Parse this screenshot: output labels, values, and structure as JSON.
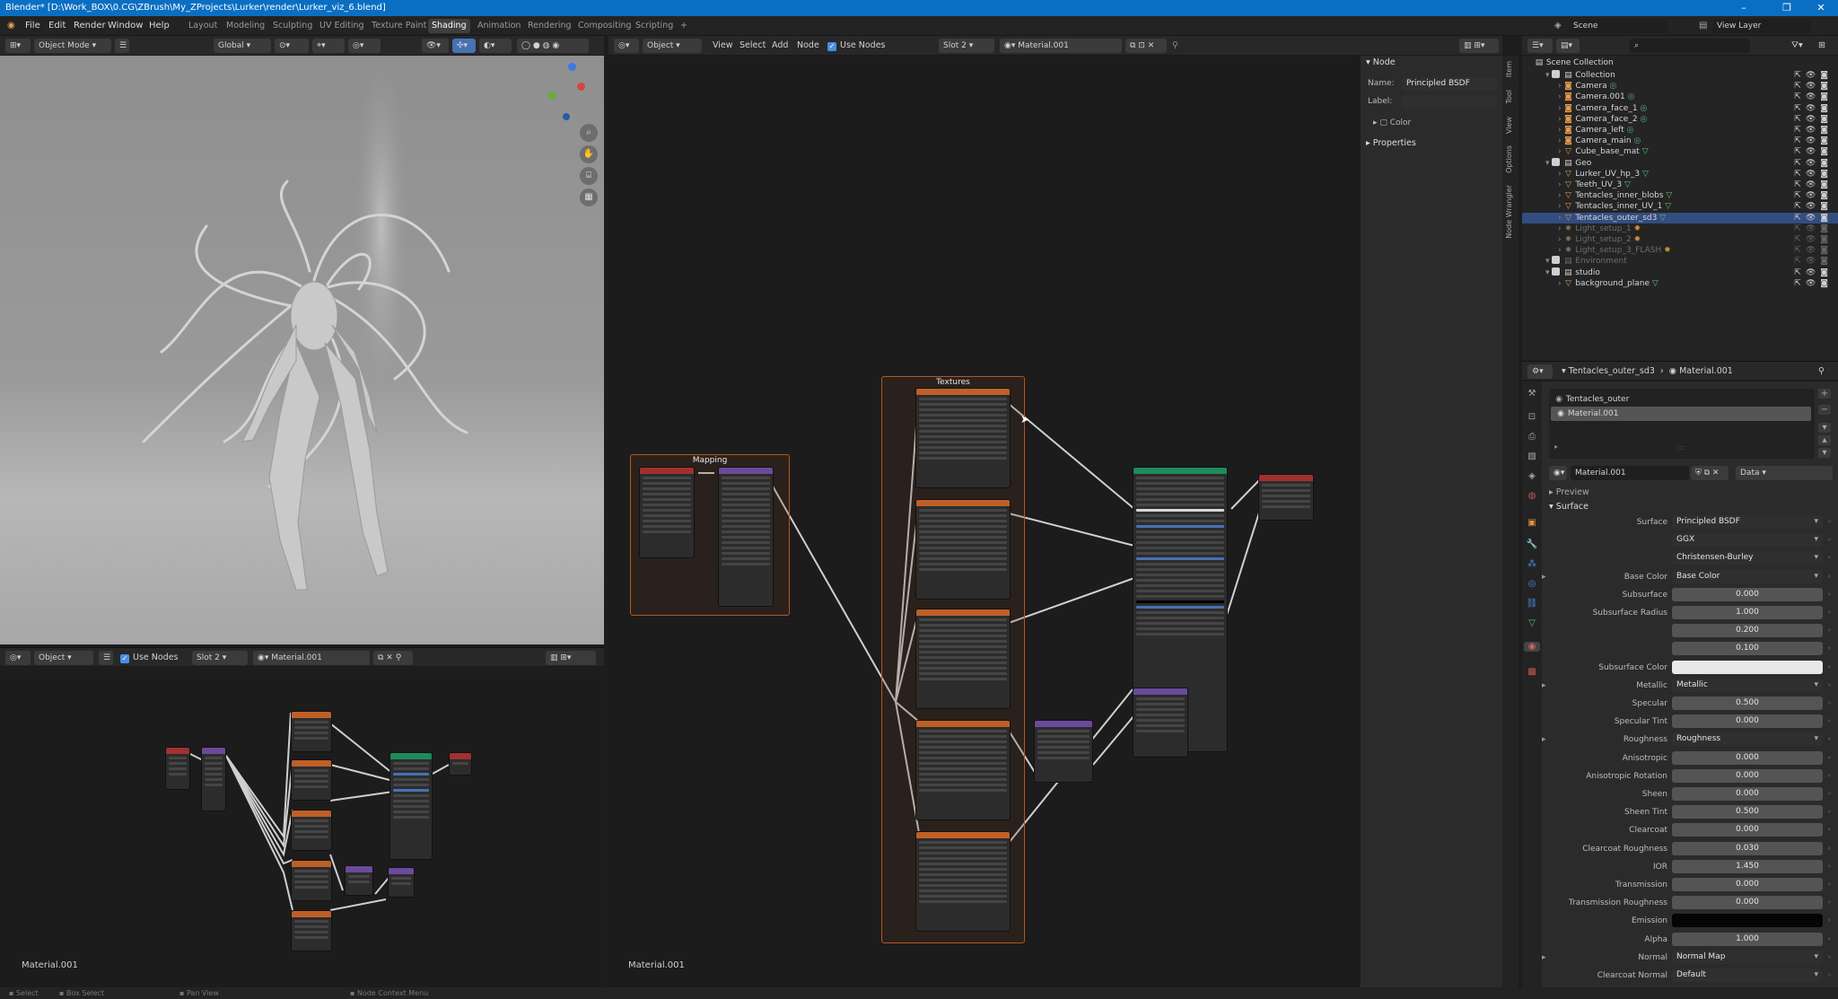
{
  "window": {
    "title": "Blender* [D:\\Work_BOX\\0.CG\\ZBrush\\My_ZProjects\\Lurker\\render\\Lurker_viz_6.blend]"
  },
  "menu": [
    "File",
    "Edit",
    "Render",
    "Window",
    "Help"
  ],
  "workspaces": [
    "Layout",
    "Modeling",
    "Sculpting",
    "UV Editing",
    "Texture Paint",
    "Shading",
    "Animation",
    "Rendering",
    "Compositing",
    "Scripting"
  ],
  "active_workspace": "Shading",
  "scene": {
    "label": "Scene",
    "view_layer": "View Layer"
  },
  "viewport": {
    "mode": "Object Mode",
    "orientation": "Global"
  },
  "node_editor": {
    "object_btn": "Object",
    "menu": [
      "View",
      "Select",
      "Add",
      "Node"
    ],
    "use_nodes": "Use Nodes",
    "slot": "Slot 2",
    "material": "Material.001",
    "footer": "Material.001"
  },
  "node_editor_small": {
    "object_btn": "Object",
    "use_nodes": "Use Nodes",
    "slot": "Slot 2",
    "material": "Material.001",
    "footer": "Material.001"
  },
  "frames": {
    "mapping": "Mapping",
    "textures": "Textures"
  },
  "node_panel": {
    "header": "Node",
    "name_label": "Name:",
    "name_value": "Principled BSDF",
    "label_label": "Label:",
    "color": "Color",
    "properties": "Properties"
  },
  "side_tabs": [
    "Item",
    "Tool",
    "View",
    "Options",
    "Node Wrangler"
  ],
  "outliner": {
    "root": "Scene Collection",
    "rows": [
      {
        "name": "Collection",
        "type": "collection"
      },
      {
        "name": "Camera",
        "type": "camera"
      },
      {
        "name": "Camera.001",
        "type": "camera"
      },
      {
        "name": "Camera_face_1",
        "type": "camera"
      },
      {
        "name": "Camera_face_2",
        "type": "camera"
      },
      {
        "name": "Camera_left",
        "type": "camera"
      },
      {
        "name": "Camera_main",
        "type": "camera"
      },
      {
        "name": "Cube_base_mat",
        "type": "mesh"
      },
      {
        "name": "Geo",
        "type": "collection"
      },
      {
        "name": "Lurker_UV_hp_3",
        "type": "mesh"
      },
      {
        "name": "Teeth_UV_3",
        "type": "mesh"
      },
      {
        "name": "Tentacles_inner_blobs",
        "type": "mesh"
      },
      {
        "name": "Tentacles_inner_UV_1",
        "type": "mesh"
      },
      {
        "name": "Tentacles_outer_sd3",
        "type": "mesh",
        "selected": true
      },
      {
        "name": "Light_setup_1",
        "type": "light",
        "dim": true
      },
      {
        "name": "Light_setup_2",
        "type": "light",
        "dim": true
      },
      {
        "name": "Light_setup_3_FLASH",
        "type": "light",
        "dim": true
      },
      {
        "name": "Environment",
        "type": "collection",
        "dim": true
      },
      {
        "name": "studio",
        "type": "collection"
      },
      {
        "name": "background_plane",
        "type": "mesh"
      }
    ]
  },
  "properties": {
    "object": "Tentacles_outer_sd3",
    "material_header": "Material.001",
    "slots": [
      "Tentacles_outer",
      "Material.001"
    ],
    "material_field": "Material.001",
    "data_dropdown": "Data",
    "preview": "Preview",
    "surface_section": "Surface",
    "rows": [
      {
        "label": "Surface",
        "value": "Principled BSDF",
        "kind": "drop"
      },
      {
        "label": "",
        "value": "GGX",
        "kind": "drop"
      },
      {
        "label": "",
        "value": "Christensen-Burley",
        "kind": "drop"
      },
      {
        "label": "Base Color",
        "value": "Base Color",
        "kind": "drop"
      },
      {
        "label": "Subsurface",
        "value": "0.000",
        "kind": "num"
      },
      {
        "label": "Subsurface Radius",
        "value": "1.000",
        "kind": "num"
      },
      {
        "label": "",
        "value": "0.200",
        "kind": "num"
      },
      {
        "label": "",
        "value": "0.100",
        "kind": "num"
      },
      {
        "label": "Subsurface Color",
        "value": "",
        "kind": "white"
      },
      {
        "label": "Metallic",
        "value": "Metallic",
        "kind": "drop"
      },
      {
        "label": "Specular",
        "value": "0.500",
        "kind": "num",
        "fill": 0.5
      },
      {
        "label": "Specular Tint",
        "value": "0.000",
        "kind": "num"
      },
      {
        "label": "Roughness",
        "value": "Roughness",
        "kind": "drop"
      },
      {
        "label": "Anisotropic",
        "value": "0.000",
        "kind": "num"
      },
      {
        "label": "Anisotropic Rotation",
        "value": "0.000",
        "kind": "num"
      },
      {
        "label": "Sheen",
        "value": "0.000",
        "kind": "num"
      },
      {
        "label": "Sheen Tint",
        "value": "0.500",
        "kind": "num",
        "fill": 0.5
      },
      {
        "label": "Clearcoat",
        "value": "0.000",
        "kind": "num"
      },
      {
        "label": "Clearcoat Roughness",
        "value": "0.030",
        "kind": "num",
        "fill": 0.03
      },
      {
        "label": "IOR",
        "value": "1.450",
        "kind": "num"
      },
      {
        "label": "Transmission",
        "value": "0.000",
        "kind": "num"
      },
      {
        "label": "Transmission Roughness",
        "value": "0.000",
        "kind": "num"
      },
      {
        "label": "Emission",
        "value": "",
        "kind": "black"
      },
      {
        "label": "Alpha",
        "value": "1.000",
        "kind": "num",
        "fill": 1.0
      },
      {
        "label": "Normal",
        "value": "Normal Map",
        "kind": "drop"
      },
      {
        "label": "Clearcoat Normal",
        "value": "Default",
        "kind": "drop"
      }
    ]
  },
  "status": {
    "left": "Select",
    "middle": "Box Select",
    "pan": "Pan View",
    "context": "Node Context Menu"
  }
}
